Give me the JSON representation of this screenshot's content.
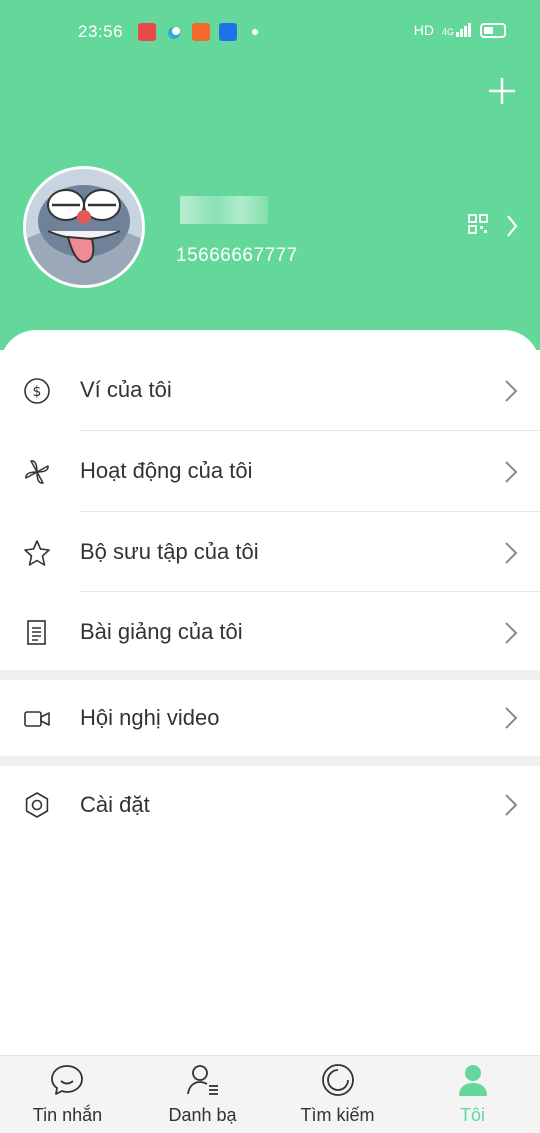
{
  "status_bar": {
    "time": "23:56",
    "network": "HD",
    "signal_label": "4G"
  },
  "profile": {
    "phone": "15666667777",
    "avatar_icon": "cartoon-avatar"
  },
  "menu": {
    "items": [
      {
        "label": "Ví của tôi",
        "icon": "dollar-coin-icon"
      },
      {
        "label": "Hoạt động của tôi",
        "icon": "pinwheel-icon"
      },
      {
        "label": "Bộ sưu tập của tôi",
        "icon": "star-icon"
      },
      {
        "label": "Bài giảng của tôi",
        "icon": "document-icon"
      },
      {
        "label": "Hội nghị video",
        "icon": "video-camera-icon"
      },
      {
        "label": "Cài đặt",
        "icon": "hexagon-settings-icon"
      }
    ]
  },
  "tabbar": {
    "tabs": [
      {
        "label": "Tin nhắn",
        "icon": "chat-bubble-icon"
      },
      {
        "label": "Danh bạ",
        "icon": "contacts-icon"
      },
      {
        "label": "Tìm kiếm",
        "icon": "discover-icon"
      },
      {
        "label": "Tôi",
        "icon": "person-icon"
      }
    ],
    "active_index": 3
  },
  "colors": {
    "accent": "#63d89a",
    "background": "#ffffff",
    "separator_band": "#f0f0f0"
  }
}
